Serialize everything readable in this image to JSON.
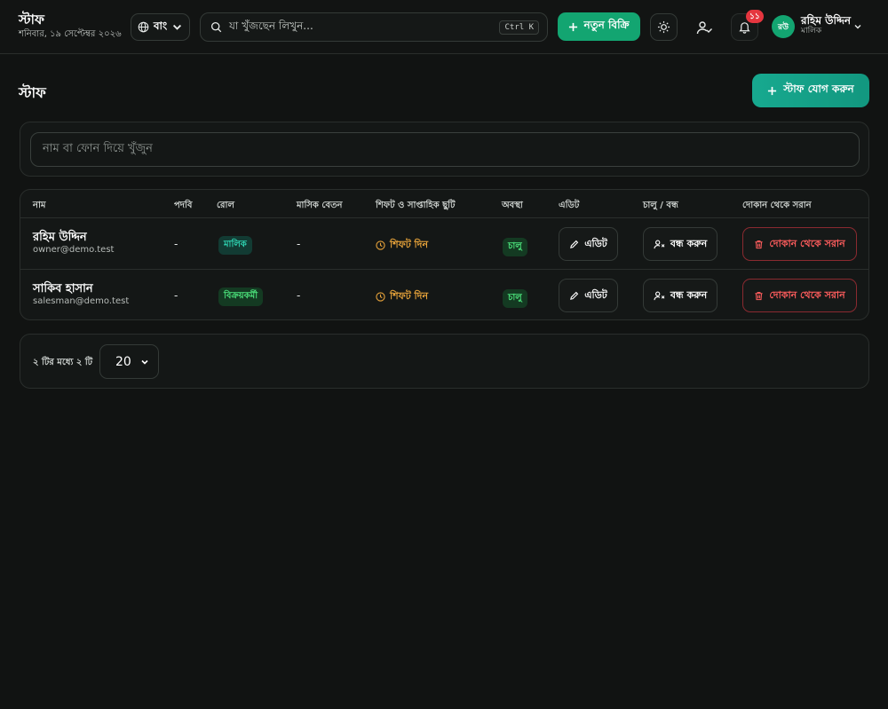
{
  "header": {
    "title": "স্টাফ",
    "date": "শনিবার, ১৯ সেপ্টেম্বর ২০২৬",
    "language": "বাং",
    "search_placeholder": "যা খুঁজছেন লিখুন...",
    "search_shortcut": "Ctrl K",
    "new_sale_label": "নতুন বিক্রি",
    "notification_count": "১১",
    "user": {
      "initials": "রউ",
      "name": "রহিম উদ্দিন",
      "role": "মালিক"
    }
  },
  "page": {
    "title": "স্টাফ",
    "add_staff_label": "স্টাফ যোগ করুন",
    "search_placeholder": "নাম বা ফোন দিয়ে খুঁজুন"
  },
  "table": {
    "columns": [
      "নাম",
      "পদবি",
      "রোল",
      "মাসিক বেতন",
      "শিফট ও সাপ্তাহিক ছুটি",
      "অবস্থা",
      "এডিট",
      "চালু / বন্ধ",
      "দোকান থেকে সরান"
    ],
    "rows": [
      {
        "name": "রহিম উদ্দিন",
        "email": "owner@demo.test",
        "designation": "-",
        "role": "মালিক",
        "salary": "-",
        "shift": "শিফট দিন",
        "status": "চালু",
        "edit_label": "এডিট",
        "toggle_label": "বন্ধ করুন",
        "remove_label": "দোকান থেকে সরান"
      },
      {
        "name": "সাকিব হাসান",
        "email": "salesman@demo.test",
        "designation": "-",
        "role": "বিক্রয়কর্মী",
        "salary": "-",
        "shift": "শিফট দিন",
        "status": "চালু",
        "edit_label": "এডিট",
        "toggle_label": "বন্ধ করুন",
        "remove_label": "দোকান থেকে সরান"
      }
    ]
  },
  "pagination": {
    "summary": "২ টির মধ্যে ২ টি",
    "page_size": "20"
  },
  "colors": {
    "primary_green": "#13a571",
    "teal": "#17a98f",
    "danger": "#ff5d5d",
    "warning": "#e7a33a"
  }
}
